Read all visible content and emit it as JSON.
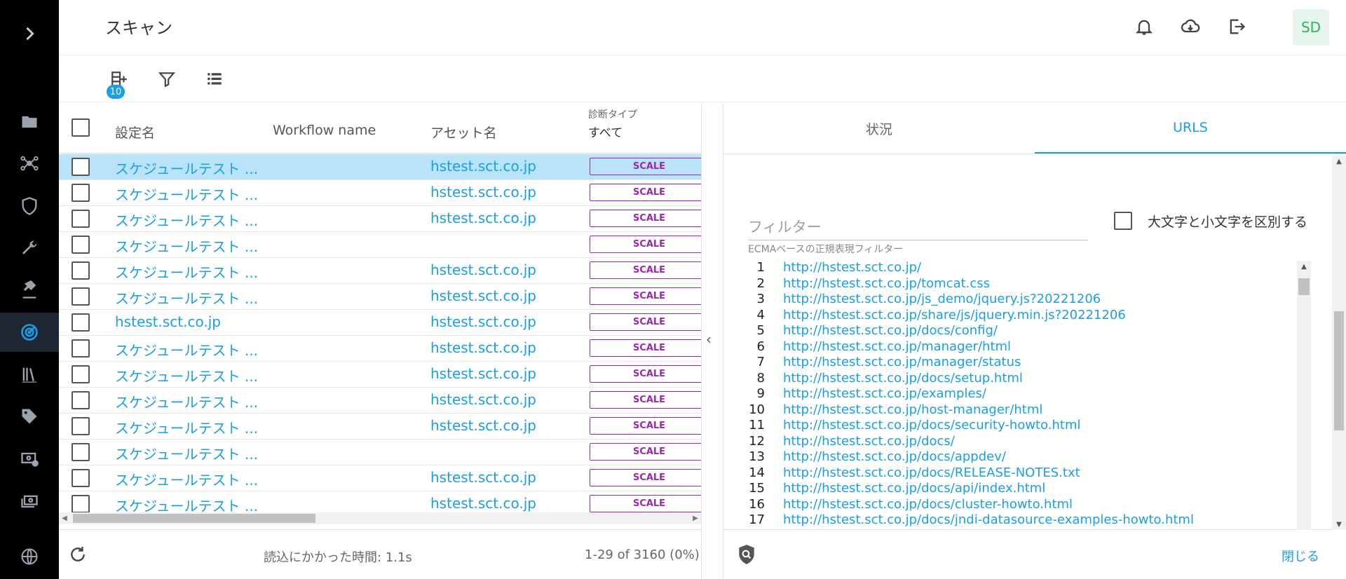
{
  "header": {
    "title": "スキャン",
    "avatar_initials": "SD",
    "icons": [
      "bell-icon",
      "cloud-download-icon",
      "logout-icon"
    ]
  },
  "nav": {
    "icons": [
      "chevron-right-icon",
      "folder-icon",
      "network-icon",
      "shield-icon",
      "wrench-icon",
      "tools-icon",
      "radar-icon",
      "library-icon",
      "tag-icon",
      "money-settings-icon",
      "money-stack-icon",
      "globe-icon"
    ],
    "active": "radar-icon"
  },
  "toolbar": {
    "add_badge": "10",
    "icons": [
      "add-row-icon",
      "filter-icon",
      "list-icon"
    ]
  },
  "table": {
    "columns": {
      "name": "設定名",
      "workflow": "Workflow name",
      "asset": "アセット名",
      "diag_type_label": "診断タイプ",
      "diag_type_value": "すべて"
    },
    "rows": [
      {
        "name": "スケジュールテスト ...",
        "asset": "hstest.sct.co.jp",
        "type": "SCALE",
        "selected": true
      },
      {
        "name": "スケジュールテスト ...",
        "asset": "hstest.sct.co.jp",
        "type": "SCALE"
      },
      {
        "name": "スケジュールテスト ...",
        "asset": "hstest.sct.co.jp",
        "type": "SCALE"
      },
      {
        "name": "スケジュールテスト ...",
        "asset": "",
        "type": "SCALE"
      },
      {
        "name": "スケジュールテスト ...",
        "asset": "hstest.sct.co.jp",
        "type": "SCALE"
      },
      {
        "name": "スケジュールテスト ...",
        "asset": "hstest.sct.co.jp",
        "type": "SCALE"
      },
      {
        "name": "hstest.sct.co.jp",
        "asset": "hstest.sct.co.jp",
        "type": "SCALE"
      },
      {
        "name": "スケジュールテスト ...",
        "asset": "hstest.sct.co.jp",
        "type": "SCALE"
      },
      {
        "name": "スケジュールテスト ...",
        "asset": "hstest.sct.co.jp",
        "type": "SCALE"
      },
      {
        "name": "スケジュールテスト ...",
        "asset": "hstest.sct.co.jp",
        "type": "SCALE"
      },
      {
        "name": "スケジュールテスト ...",
        "asset": "hstest.sct.co.jp",
        "type": "SCALE"
      },
      {
        "name": "スケジュールテスト ...",
        "asset": "",
        "type": "SCALE"
      },
      {
        "name": "スケジュールテスト ...",
        "asset": "hstest.sct.co.jp",
        "type": "SCALE"
      },
      {
        "name": "スケジュールテスト ...",
        "asset": "hstest.sct.co.jp",
        "type": "SCALE"
      }
    ],
    "footer": {
      "load_time": "読込にかかった時間: 1.1s",
      "range": "1-29 of 3160 (0%)"
    }
  },
  "detail": {
    "tabs": [
      {
        "label": "状況",
        "active": false
      },
      {
        "label": "URLS",
        "active": true
      }
    ],
    "filter": {
      "placeholder": "フィルター",
      "value": "",
      "hint": "ECMAベースの正規表現フィルター",
      "case_label": "大文字と小文字を区別する"
    },
    "urls": [
      "http://hstest.sct.co.jp/",
      "http://hstest.sct.co.jp/tomcat.css",
      "http://hstest.sct.co.jp/js_demo/jquery.js?20221206",
      "http://hstest.sct.co.jp/share/js/jquery.min.js?20221206",
      "http://hstest.sct.co.jp/docs/config/",
      "http://hstest.sct.co.jp/manager/html",
      "http://hstest.sct.co.jp/manager/status",
      "http://hstest.sct.co.jp/docs/setup.html",
      "http://hstest.sct.co.jp/examples/",
      "http://hstest.sct.co.jp/host-manager/html",
      "http://hstest.sct.co.jp/docs/security-howto.html",
      "http://hstest.sct.co.jp/docs/",
      "http://hstest.sct.co.jp/docs/appdev/",
      "http://hstest.sct.co.jp/docs/RELEASE-NOTES.txt",
      "http://hstest.sct.co.jp/docs/api/index.html",
      "http://hstest.sct.co.jp/docs/cluster-howto.html",
      "http://hstest.sct.co.jp/docs/jndi-datasource-examples-howto.html"
    ],
    "close_label": "閉じる"
  },
  "colors": {
    "accent": "#1a9ee6",
    "nav_bg": "#000000",
    "selected_row": "#b9e3f8",
    "scale_badge": "#9c27b0",
    "avatar_text": "#2db35d"
  }
}
